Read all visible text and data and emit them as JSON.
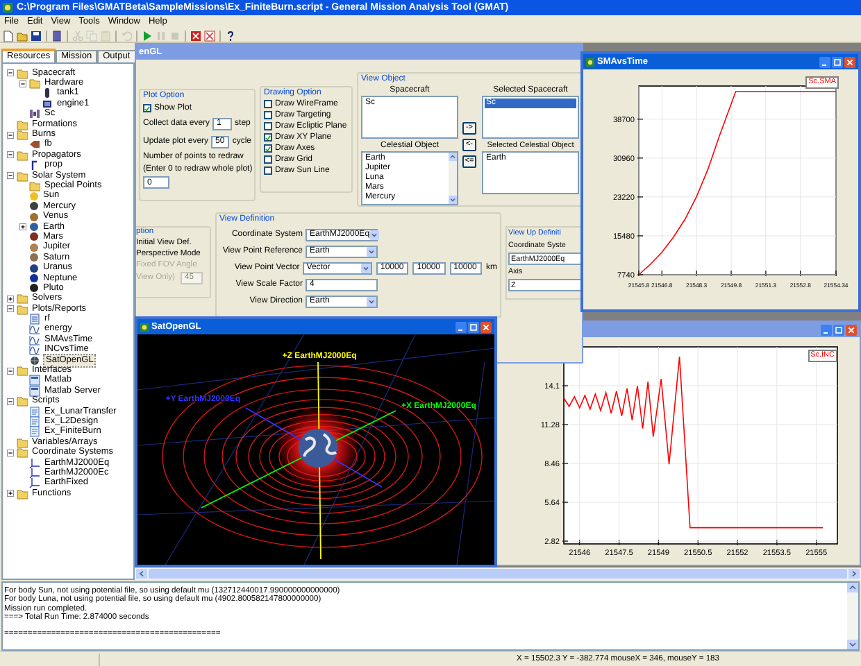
{
  "window": {
    "title": "C:\\Program Files\\GMATBeta\\SampleMissions\\Ex_FiniteBurn.script - General Mission Analysis Tool (GMAT)"
  },
  "menu": [
    "File",
    "Edit",
    "View",
    "Tools",
    "Window",
    "Help"
  ],
  "toolbar_groups": [
    {
      "tools": [
        {
          "kind": "new",
          "disabled": false
        },
        {
          "kind": "open",
          "disabled": false
        },
        {
          "kind": "save",
          "disabled": false
        }
      ]
    },
    {
      "tools": [
        {
          "kind": "book",
          "disabled": false
        }
      ]
    },
    {
      "tools": [
        {
          "kind": "cut",
          "disabled": true
        },
        {
          "kind": "copy",
          "disabled": true
        },
        {
          "kind": "paste",
          "disabled": true
        }
      ]
    },
    {
      "tools": [
        {
          "kind": "undo",
          "disabled": true
        }
      ]
    },
    {
      "tools": [
        {
          "kind": "run",
          "disabled": false
        },
        {
          "kind": "pause",
          "disabled": true
        },
        {
          "kind": "stop",
          "disabled": true
        }
      ]
    },
    {
      "tools": [
        {
          "kind": "close",
          "disabled": false
        },
        {
          "kind": "clear",
          "disabled": false
        }
      ]
    },
    {
      "tools": [
        {
          "kind": "help",
          "disabled": false
        }
      ]
    }
  ],
  "tabs": [
    {
      "label": "Resources",
      "selected": true
    },
    {
      "label": "Mission",
      "selected": false
    },
    {
      "label": "Output",
      "selected": false
    }
  ],
  "tree": [
    {
      "label": "Spacecraft",
      "kind": "folder",
      "expanded": true,
      "selected": false,
      "children": [
        {
          "label": "Hardware",
          "kind": "folder",
          "expanded": true,
          "selected": false,
          "children": [
            {
              "label": "tank1",
              "kind": "tank",
              "selected": false
            },
            {
              "label": "engine1",
              "kind": "engine",
              "selected": false
            }
          ]
        },
        {
          "label": "Sc",
          "kind": "spacecraft",
          "selected": false
        }
      ]
    },
    {
      "label": "Formations",
      "kind": "folder",
      "selected": false
    },
    {
      "label": "Burns",
      "kind": "folder",
      "expanded": true,
      "selected": false,
      "children": [
        {
          "label": "fb",
          "kind": "burn",
          "selected": false
        }
      ]
    },
    {
      "label": "Propagators",
      "kind": "folder",
      "expanded": true,
      "selected": false,
      "children": [
        {
          "label": "prop",
          "kind": "propagator",
          "selected": false
        }
      ]
    },
    {
      "label": "Solar System",
      "kind": "folder",
      "expanded": true,
      "selected": false,
      "children": [
        {
          "label": "Special Points",
          "kind": "folder",
          "selected": false
        },
        {
          "label": "Sun",
          "kind": "body",
          "color": "#f0c020",
          "selected": false
        },
        {
          "label": "Mercury",
          "kind": "body",
          "color": "#404040",
          "selected": false
        },
        {
          "label": "Venus",
          "kind": "body",
          "color": "#a07030",
          "selected": false
        },
        {
          "label": "Earth",
          "kind": "body",
          "color": "#3060a0",
          "expanded": false,
          "selected": false
        },
        {
          "label": "Mars",
          "kind": "body",
          "color": "#803020",
          "selected": false
        },
        {
          "label": "Jupiter",
          "kind": "body",
          "color": "#b08050",
          "selected": false
        },
        {
          "label": "Saturn",
          "kind": "body",
          "color": "#907050",
          "selected": false
        },
        {
          "label": "Uranus",
          "kind": "body",
          "color": "#204080",
          "selected": false
        },
        {
          "label": "Neptune",
          "kind": "body",
          "color": "#1030a0",
          "selected": false
        },
        {
          "label": "Pluto",
          "kind": "body",
          "color": "#202020",
          "selected": false
        }
      ]
    },
    {
      "label": "Solvers",
      "kind": "folder",
      "expanded": false,
      "selected": false
    },
    {
      "label": "Plots/Reports",
      "kind": "folder",
      "expanded": true,
      "selected": false,
      "children": [
        {
          "label": "rf",
          "kind": "report",
          "selected": false
        },
        {
          "label": "energy",
          "kind": "plot",
          "selected": false
        },
        {
          "label": "SMAvsTime",
          "kind": "plot",
          "selected": false
        },
        {
          "label": "INCvsTime",
          "kind": "plot",
          "selected": false
        },
        {
          "label": "SatOpenGL",
          "kind": "opengl",
          "selected": true
        }
      ]
    },
    {
      "label": "Interfaces",
      "kind": "folder",
      "expanded": true,
      "selected": false,
      "children": [
        {
          "label": "Matlab",
          "kind": "interface",
          "selected": false
        },
        {
          "label": "Matlab Server",
          "kind": "interface",
          "selected": false
        }
      ]
    },
    {
      "label": "Scripts",
      "kind": "folder",
      "expanded": true,
      "selected": false,
      "children": [
        {
          "label": "Ex_LunarTransfer",
          "kind": "script",
          "selected": false
        },
        {
          "label": "Ex_L2Design",
          "kind": "script",
          "selected": false
        },
        {
          "label": "Ex_FiniteBurn",
          "kind": "script",
          "selected": false
        }
      ]
    },
    {
      "label": "Variables/Arrays",
      "kind": "folder",
      "selected": false
    },
    {
      "label": "Coordinate Systems",
      "kind": "folder",
      "expanded": true,
      "selected": false,
      "children": [
        {
          "label": "EarthMJ2000Eq",
          "kind": "coordsys",
          "selected": false
        },
        {
          "label": "EarthMJ2000Ec",
          "kind": "coordsys",
          "selected": false
        },
        {
          "label": "EarthFixed",
          "kind": "coordsys",
          "selected": false
        }
      ]
    },
    {
      "label": "Functions",
      "kind": "folder",
      "expanded": false,
      "selected": false
    }
  ],
  "config": {
    "title": "enGL",
    "plot_option": {
      "title": "Plot Option",
      "show_plot": {
        "label": "Show Plot",
        "checked": true
      },
      "fields": [
        {
          "label": "Collect data every",
          "value": "1",
          "unit": "step"
        },
        {
          "label": "Update plot every",
          "value": "50",
          "unit": "cycle"
        }
      ],
      "redraw_label": "Number of points to redraw",
      "redraw_hint": "(Enter 0 to redraw whole plot)",
      "redraw_value": "0"
    },
    "drawing_option": {
      "title": "Drawing Option",
      "options": [
        {
          "label": "Draw WireFrame",
          "checked": false
        },
        {
          "label": "Draw Targeting",
          "checked": false
        },
        {
          "label": "Draw Ecliptic Plane",
          "checked": false
        },
        {
          "label": "Draw XY Plane",
          "checked": true
        },
        {
          "label": "Draw Axes",
          "checked": true
        },
        {
          "label": "Draw Grid",
          "checked": false
        },
        {
          "label": "Draw Sun Line",
          "checked": false
        }
      ]
    },
    "view_object": {
      "title": "View Object",
      "spacecraft": {
        "label": "Spacecraft",
        "items": [
          {
            "text": "Sc",
            "selected": false
          }
        ]
      },
      "selected_spacecraft": {
        "label": "Selected Spacecraft",
        "items": [
          {
            "text": "Sc",
            "selected": true
          }
        ]
      },
      "buttons": [
        "->",
        "<-",
        "<="
      ],
      "celestial": {
        "label": "Celestial Object",
        "items": [
          {
            "text": "Earth",
            "selected": false
          },
          {
            "text": "Jupiter",
            "selected": false
          },
          {
            "text": "Luna",
            "selected": false
          },
          {
            "text": "Mars",
            "selected": false
          },
          {
            "text": "Mercury",
            "selected": false
          }
        ]
      },
      "selected_celestial": {
        "label": "Selected Celestial Object",
        "items": [
          {
            "text": "Earth",
            "selected": false
          }
        ]
      }
    },
    "view_options": {
      "title": "ption",
      "items": [
        {
          "text": "Initial View Def.",
          "disabled": false
        },
        {
          "text": "Perspective Mode",
          "disabled": false
        },
        {
          "text": "Fixed FOV Angle",
          "disabled": true
        },
        {
          "text": "View Only)",
          "disabled": true
        }
      ],
      "fov": {
        "value": "45",
        "disabled": true
      }
    },
    "view_definition": {
      "title": "View Definition",
      "rows": [
        {
          "label": "Coordinate System",
          "kind": "dropdown",
          "value": "EarthMJ2000Eq"
        },
        {
          "label": "View Point Reference",
          "kind": "dropdown",
          "value": "Earth"
        },
        {
          "label": "View Point Vector",
          "kind": "dropdown",
          "value": "Vector",
          "extra": [
            "10000",
            "10000",
            "10000"
          ],
          "unit": "km"
        },
        {
          "label": "View Scale Factor",
          "kind": "text",
          "value": "4"
        },
        {
          "label": "View Direction",
          "kind": "dropdown",
          "value": "Earth"
        }
      ]
    },
    "view_up": {
      "title": "View Up Definiti",
      "coord_label": "Coordinate Syste",
      "coord_value": "EarthMJ2000Eq",
      "axis_label": "Axis",
      "axis_value": "Z"
    }
  },
  "sma_window": {
    "title": "SMAvsTime",
    "chart_data": {
      "type": "line",
      "x": [
        21545.8,
        21546.3,
        21546.8,
        21547.3,
        21547.8,
        21548.3,
        21548.8,
        21549.3,
        21550,
        21554.34
      ],
      "series": [
        {
          "name": "Sc.SMA",
          "color": "#ff0000",
          "values": [
            7740,
            9800,
            12200,
            15200,
            18800,
            23300,
            28800,
            35500,
            44200,
            44200
          ]
        }
      ],
      "xlim": [
        21545.8,
        21554.34
      ],
      "ylim": [
        7740,
        45300
      ],
      "grid": true,
      "xticks": [
        21545.8,
        21546.8,
        21548.3,
        21549.8,
        21551.3,
        21552.8,
        21554.34
      ],
      "yticks": [
        7740,
        15480,
        23220,
        30960,
        38700
      ]
    }
  },
  "inc_window": {
    "chart_data": {
      "type": "line",
      "x": [
        21545.4,
        21545.6,
        21545.8,
        21546.0,
        21546.2,
        21546.4,
        21546.6,
        21546.8,
        21547.0,
        21547.2,
        21547.4,
        21547.6,
        21547.8,
        21548.0,
        21548.2,
        21548.4,
        21548.6,
        21548.8,
        21549.1,
        21549.4,
        21549.8,
        21550.2,
        21555.25
      ],
      "series": [
        {
          "name": "Sc.INC",
          "color": "#ff0000",
          "values": [
            13.2,
            12.6,
            13.3,
            12.5,
            13.4,
            12.4,
            13.5,
            12.3,
            13.6,
            12.1,
            13.7,
            11.9,
            13.9,
            11.6,
            14.1,
            11.0,
            14.4,
            10.4,
            14.6,
            8.4,
            16.2,
            3.8,
            3.8
          ]
        }
      ],
      "xlim": [
        21545.4,
        21555.8
      ],
      "ylim": [
        2.62,
        16.92
      ],
      "grid": true,
      "xticks": [
        {
          "value": 21546,
          "label": "21546"
        },
        {
          "value": 21547.5,
          "label": "21547.5"
        },
        {
          "value": 21549,
          "label": "21549"
        },
        {
          "value": 21550.5,
          "label": "21550.5"
        },
        {
          "value": 21552,
          "label": "21552"
        },
        {
          "value": 21553.5,
          "label": "21553.5"
        },
        {
          "value": 21555,
          "label": "21555"
        }
      ],
      "yticks": [
        {
          "value": 2.82,
          "label": "2.82"
        },
        {
          "value": 5.64,
          "label": "5.64"
        },
        {
          "value": 8.46,
          "label": "8.46"
        },
        {
          "value": 11.28,
          "label": "11.28"
        },
        {
          "value": 14.1,
          "label": "14.1"
        }
      ]
    }
  },
  "gl_window": {
    "title": "SatOpenGL",
    "axes": [
      {
        "kind": "z",
        "label": "+Z EarthMJ2000Eq",
        "color": "#ffff00"
      },
      {
        "kind": "y",
        "label": "+Y EarthMJ2000Eq",
        "color": "#3333ff"
      },
      {
        "kind": "x",
        "label": "+X EarthMJ2000Eq",
        "color": "#00ff00"
      }
    ]
  },
  "output": {
    "lines": [
      "For body Sun, not using potential file, so using default mu (132712440017.990000000000000)",
      "For body Luna, not using potential file, so using default mu (4902.800582147800000000)",
      "Mission run completed.",
      "===> Total Run Time: 2.874000 seconds"
    ],
    "rule": "=============================================="
  },
  "status_bar": {
    "text": "X = 15502.3 Y = -382.774 mouseX = 346, mouseY = 183"
  }
}
